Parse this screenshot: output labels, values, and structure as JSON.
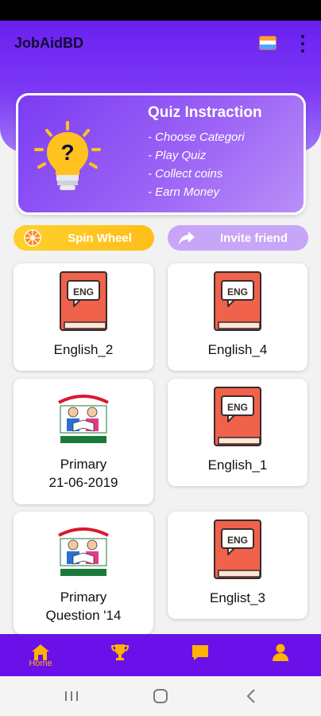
{
  "app": {
    "title": "JobAidBD"
  },
  "quiz_card": {
    "title": "Quiz Instraction",
    "steps": [
      "- Choose Categori",
      "- Play Quiz",
      "- Collect coins",
      "- Earn Money"
    ]
  },
  "actions": {
    "spin_label": "Spin Wheel",
    "invite_label": "Invite friend"
  },
  "categories": [
    {
      "label": "English_2",
      "icon": "eng-book-icon",
      "badge": "ENG"
    },
    {
      "label": "English_4",
      "icon": "eng-book-icon",
      "badge": "ENG"
    },
    {
      "label_line1": "Primary",
      "label_line2": "21-06-2019",
      "icon": "primary-education-logo"
    },
    {
      "label": "English_1",
      "icon": "eng-book-icon",
      "badge": "ENG"
    },
    {
      "label_line1": "Primary",
      "label_line2": "Question '14",
      "icon": "primary-education-logo"
    },
    {
      "label": "Englist_3",
      "icon": "eng-book-icon",
      "badge": "ENG"
    }
  ],
  "bottom_nav": {
    "items": [
      {
        "label": "Home",
        "icon": "home-icon",
        "active": true
      },
      {
        "label": "",
        "icon": "trophy-icon"
      },
      {
        "label": "",
        "icon": "message-icon"
      },
      {
        "label": "",
        "icon": "profile-icon"
      }
    ]
  },
  "colors": {
    "primary": "#6a10e8",
    "accent": "#ffb300",
    "book": "#f0624a",
    "spin_pill": "#ffc21f",
    "invite_pill": "#c8a6f7"
  }
}
